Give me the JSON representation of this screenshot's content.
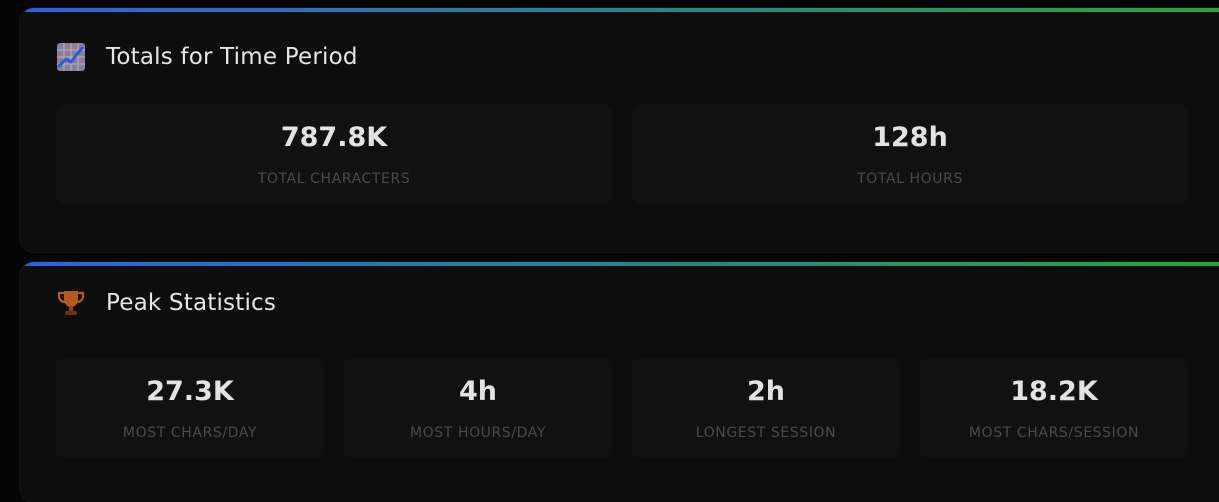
{
  "theme": {
    "accent_gradient_start": "#2b62e0",
    "accent_gradient_end": "#22a83a",
    "panel_bg": "#0d0d0d",
    "card_bg": "#111111"
  },
  "totals": {
    "title": "Totals for Time Period",
    "icon": "chart-increasing-icon",
    "stats": [
      {
        "value": "787.8K",
        "label": "TOTAL CHARACTERS"
      },
      {
        "value": "128h",
        "label": "TOTAL HOURS"
      }
    ]
  },
  "peak": {
    "title": "Peak Statistics",
    "icon": "trophy-icon",
    "stats": [
      {
        "value": "27.3K",
        "label": "MOST CHARS/DAY"
      },
      {
        "value": "4h",
        "label": "MOST HOURS/DAY"
      },
      {
        "value": "2h",
        "label": "LONGEST SESSION"
      },
      {
        "value": "18.2K",
        "label": "MOST CHARS/SESSION"
      }
    ]
  }
}
